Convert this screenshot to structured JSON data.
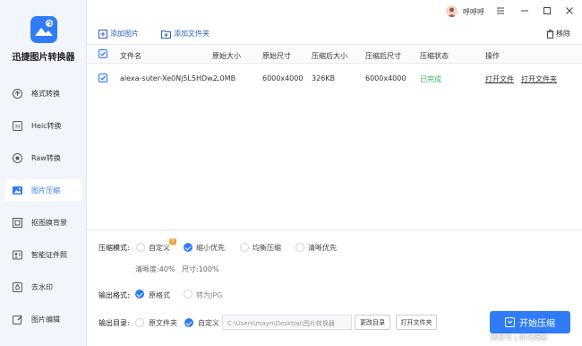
{
  "app": {
    "name": "迅捷图片转换器",
    "brand_color": "#2f7cf6"
  },
  "user": {
    "name": "呼呼呼"
  },
  "sidebar": {
    "items": [
      {
        "label": "格式转换",
        "icon": "format-convert-icon"
      },
      {
        "label": "Heic转换",
        "icon": "heic-icon"
      },
      {
        "label": "Raw转换",
        "icon": "raw-icon"
      },
      {
        "label": "图片压缩",
        "icon": "image-compress-icon",
        "active": true
      },
      {
        "label": "抠图换背景",
        "icon": "cutout-icon"
      },
      {
        "label": "智能证件照",
        "icon": "id-photo-icon"
      },
      {
        "label": "去水印",
        "icon": "watermark-remove-icon"
      },
      {
        "label": "图片编辑",
        "icon": "image-edit-icon"
      }
    ]
  },
  "toolbar": {
    "add_image": "添加图片",
    "add_folder": "添加文件夹",
    "remove": "移除"
  },
  "table": {
    "headers": [
      "文件名",
      "原始大小",
      "原始尺寸",
      "压缩后大小",
      "压缩后尺寸",
      "压缩状态",
      "操作"
    ],
    "rows": [
      {
        "filename": "alexa-suter-Xe0Nj5L5HDw...",
        "orig_size": "2.0MB",
        "orig_dim": "6000x4000",
        "new_size": "326KB",
        "new_dim": "6000x4000",
        "status": "已完成",
        "action_open_file": "打开文件",
        "action_open_folder": "打开文件夹"
      }
    ]
  },
  "compress": {
    "label": "压缩模式:",
    "options": [
      "自定义",
      "缩小优先",
      "均衡压缩",
      "清晰优先"
    ],
    "selected": "缩小优先",
    "clarity": "清晰度:40%",
    "size": "尺寸:100%"
  },
  "output_format": {
    "label": "输出格式:",
    "options": [
      "原格式",
      "转为JPG"
    ],
    "selected": "原格式"
  },
  "output_dir": {
    "label": "输出目录:",
    "options": [
      "原文件夹",
      "自定义"
    ],
    "selected": "自定义",
    "path": "C:\\Users\\mayn\\Desktop\\图片转换器",
    "change_dir": "更改目录",
    "open_folder": "打开文件夹"
  },
  "start_button": "开始压缩",
  "watermark_text": "网易号 | 职场隔壁"
}
